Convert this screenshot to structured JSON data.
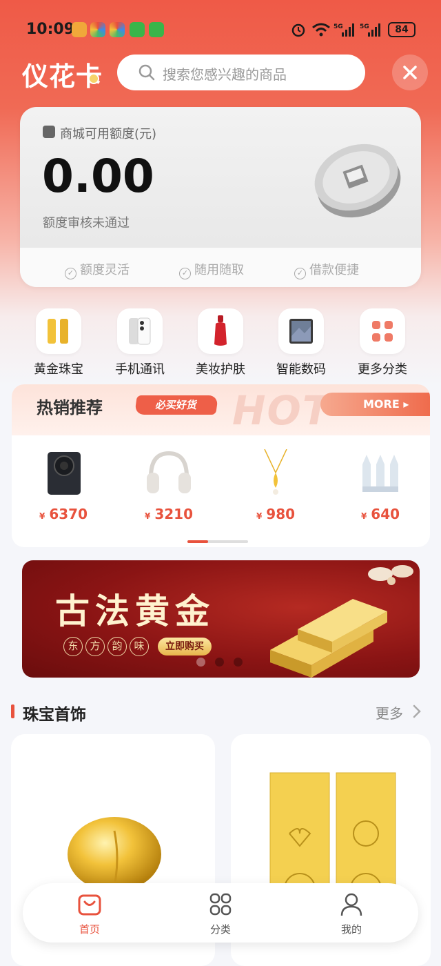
{
  "status_bar": {
    "time": "10:09",
    "battery": "84",
    "network": "5G"
  },
  "header": {
    "brand": "仪花卡",
    "search_placeholder": "搜索您感兴趣的商品"
  },
  "credit": {
    "label": "商城可用额度(元)",
    "amount": "0.00",
    "status": "额度审核未通过",
    "features": [
      "额度灵活",
      "随用随取",
      "借款便捷"
    ]
  },
  "categories": [
    {
      "label": "黄金珠宝",
      "icon": "gold-bar-icon"
    },
    {
      "label": "手机通讯",
      "icon": "phone-icon"
    },
    {
      "label": "美妆护肤",
      "icon": "cosmetics-icon"
    },
    {
      "label": "智能数码",
      "icon": "tablet-icon"
    },
    {
      "label": "更多分类",
      "icon": "grid-icon"
    }
  ],
  "hot": {
    "title": "热销推荐",
    "tag": "必买好货",
    "watermark": "HOT",
    "more": "MORE",
    "products": [
      {
        "name": "phone",
        "currency": "¥",
        "price": "6370"
      },
      {
        "name": "headphones",
        "currency": "¥",
        "price": "3210"
      },
      {
        "name": "gold-necklace",
        "currency": "¥",
        "price": "980"
      },
      {
        "name": "skincare",
        "currency": "¥",
        "price": "640"
      }
    ]
  },
  "banner": {
    "title": "古法黄金",
    "seals": [
      "东",
      "方",
      "韵",
      "味"
    ],
    "cta": "立即购买"
  },
  "jewelry": {
    "title": "珠宝首饰",
    "more": "更多"
  },
  "tabbar": [
    {
      "label": "首页",
      "icon": "bag-icon",
      "active": true
    },
    {
      "label": "分类",
      "icon": "grid-icon",
      "active": false
    },
    {
      "label": "我的",
      "icon": "user-icon",
      "active": false
    }
  ],
  "colors": {
    "brand_red": "#ef5a47",
    "price_red": "#e8523d",
    "gold": "#f2c23a"
  }
}
